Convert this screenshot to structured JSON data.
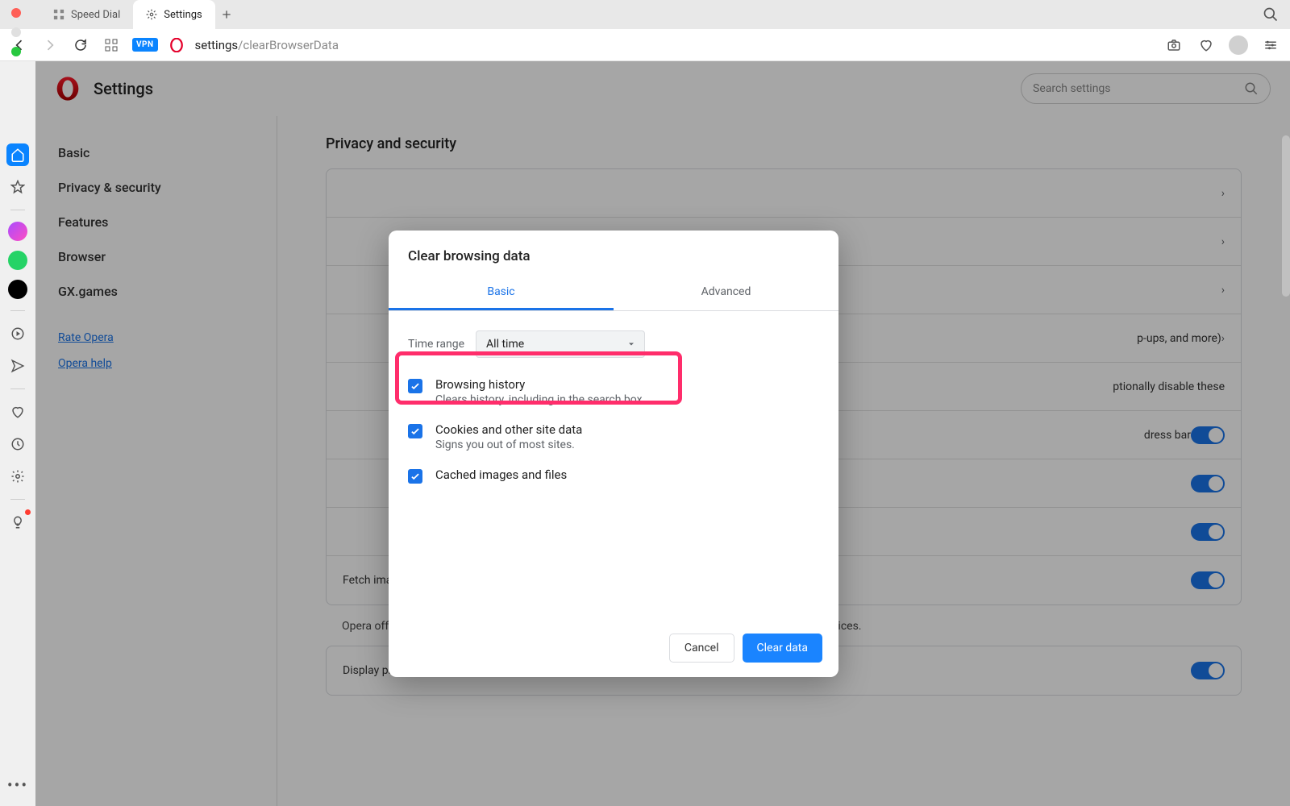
{
  "window": {
    "tabs": [
      {
        "label": "Speed Dial",
        "active": false
      },
      {
        "label": "Settings",
        "active": true
      }
    ]
  },
  "address": {
    "prefix": "settings",
    "path": "/clearBrowserData"
  },
  "settings": {
    "title": "Settings",
    "search_placeholder": "Search settings",
    "nav": {
      "items": [
        "Basic",
        "Privacy & security",
        "Features",
        "Browser",
        "GX.games"
      ],
      "links": [
        "Rate Opera",
        "Opera help"
      ]
    },
    "section": "Privacy and security",
    "rows": {
      "r1": "",
      "r2": "",
      "r3": "",
      "r4_tail": "p-ups, and more)",
      "r5_tail": "ptionally disable these",
      "r6_tail": "dress bar",
      "r7_text": "Fetch images for suggested sources in News, based on history",
      "r8_text": "Opera offers promotional content in some browser locations. You may optionally disable these services.",
      "r9_text": "Display promotional notifications"
    }
  },
  "dialog": {
    "title": "Clear browsing data",
    "tabs": {
      "basic": "Basic",
      "advanced": "Advanced"
    },
    "range_label": "Time range",
    "range_value": "All time",
    "options": [
      {
        "title": "Browsing history",
        "desc": "Clears history, including in the search box"
      },
      {
        "title": "Cookies and other site data",
        "desc": "Signs you out of most sites."
      },
      {
        "title": "Cached images and files",
        "desc": ""
      }
    ],
    "cancel": "Cancel",
    "confirm": "Clear data"
  }
}
